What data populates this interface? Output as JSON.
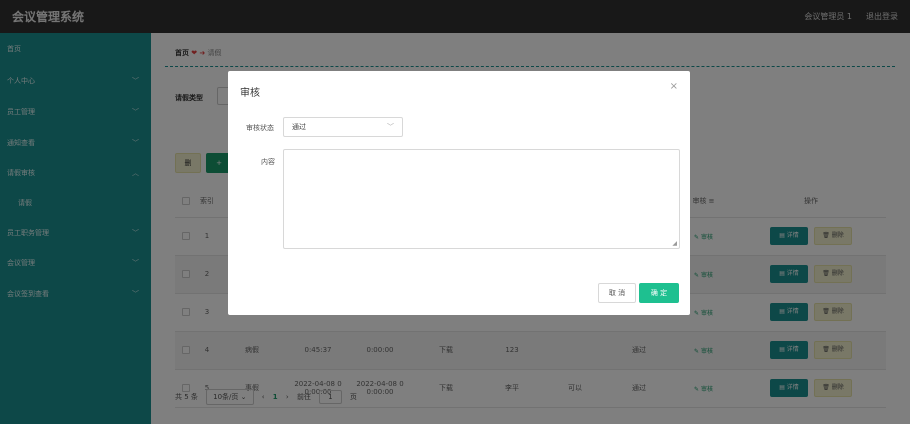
{
  "header": {
    "title": "会议管理系统",
    "user": "会议管理员 1",
    "logout": "退出登录"
  },
  "sidebar": {
    "items": [
      {
        "label": "首页"
      },
      {
        "label": "个人中心"
      },
      {
        "label": "员工管理"
      },
      {
        "label": "通知查看"
      },
      {
        "label": "请假审核"
      },
      {
        "label": "请假"
      },
      {
        "label": "员工职务管理"
      },
      {
        "label": "会议管理"
      },
      {
        "label": "会议签到查看"
      }
    ]
  },
  "breadcrumb": {
    "home": "首页",
    "sep": "➜",
    "current": "请假"
  },
  "search": {
    "label": "请假类型",
    "placeholder": ""
  },
  "toolbar": {
    "delete_label": "删",
    "add_label": "+"
  },
  "table": {
    "headers": {
      "index": "索引",
      "audit": "审核 ≡",
      "operation": "操作"
    },
    "rows": [
      {
        "index": "1",
        "c1": "",
        "c2": "",
        "c3": "",
        "c4": "",
        "c5": "",
        "c6": "",
        "c7": "",
        "audit": "审核"
      },
      {
        "index": "2",
        "c1": "",
        "c2": "",
        "c3": "",
        "c4": "",
        "c5": "",
        "c6": "",
        "c7": "",
        "audit": "审核"
      },
      {
        "index": "3",
        "c1": "",
        "c2": "",
        "c3": "",
        "c4": "",
        "c5": "",
        "c6": "",
        "c7": "",
        "audit": "审核"
      },
      {
        "index": "4",
        "c1": "病假",
        "c2": "0:45:37",
        "c3": "0:00:00",
        "c4": "下载",
        "c5": "123",
        "c6": "",
        "c7": "通过",
        "audit": "审核"
      },
      {
        "index": "5",
        "c1": "事假",
        "c2": "2022-04-08 0\n0:00:00",
        "c3": "2022-04-08 0\n0:00:00",
        "c4": "下载",
        "c5": "李平",
        "c6": "可以",
        "c7": "通过",
        "audit": "审核"
      }
    ],
    "detail_label": "▤ 详情",
    "delete_label": "🗑 删除"
  },
  "pager": {
    "total": "共 5 条",
    "size": "10条/页 ⌄",
    "prev": "‹",
    "current": "1",
    "next": "›",
    "goto": "前往",
    "page": "1",
    "unit": "页"
  },
  "dialog": {
    "title": "审核",
    "close": "×",
    "status_label": "审核状态",
    "status_value": "通过",
    "content_label": "内容",
    "content_value": "",
    "cancel": "取 消",
    "confirm": "确 定"
  },
  "colors": {
    "sidebar": "#1a9191",
    "header": "#313131",
    "confirm": "#1ec090"
  }
}
